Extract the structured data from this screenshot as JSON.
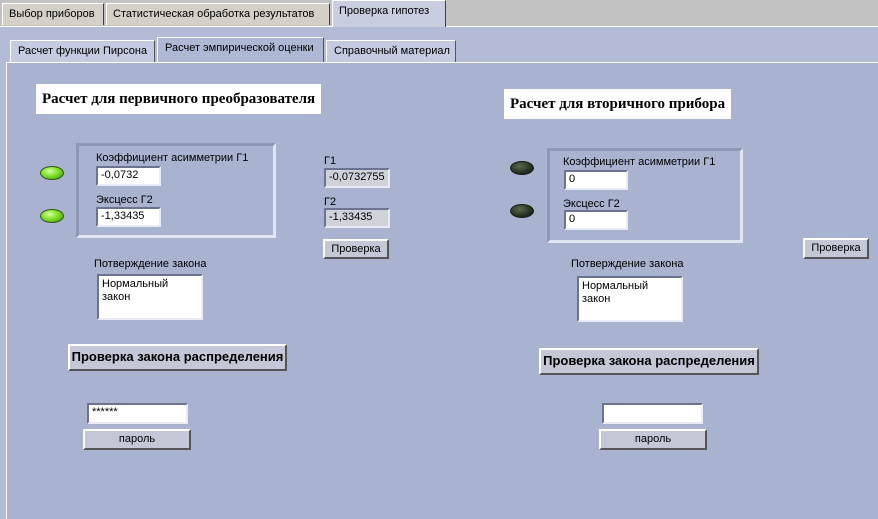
{
  "top_tabs": [
    {
      "label": "Выбор приборов"
    },
    {
      "label": "Статистическая обработка результатов"
    },
    {
      "label": "Проверка гипотез"
    }
  ],
  "sub_tabs": [
    {
      "label": "Расчет функции Пирсона"
    },
    {
      "label": "Расчет эмпирической оценки"
    },
    {
      "label": "Справочный материал"
    }
  ],
  "left": {
    "title": "Расчет для первичного преобразователя",
    "asym_label": "Коэффициент асимметрии Г1",
    "asym_value": "-0,0732",
    "excess_label": "Эксцесс Г2",
    "excess_value": "-1,33435",
    "g1_label": "Г1",
    "g1_value": "-0,0732755",
    "g2_label": "Г2",
    "g2_value": "-1,33435",
    "check_button": "Проверка",
    "confirm_label": "Потверждение закона",
    "confirm_value": "Нормальный закон",
    "law_button": "Проверка закона распределения",
    "password_value": "******",
    "password_button": "пароль",
    "led_asym": "on",
    "led_excess": "on"
  },
  "right": {
    "title": "Расчет для вторичного прибора",
    "asym_label": "Коэффициент асимметрии Г1",
    "asym_value": "0",
    "excess_label": "Эксцесс Г2",
    "excess_value": "0",
    "check_button": "Проверка",
    "confirm_label": "Потверждение закона",
    "confirm_value": "Нормальный\nзакон",
    "law_button": "Проверка закона распределения",
    "password_value": "",
    "password_button": "пароль",
    "led_asym": "off",
    "led_excess": "off"
  }
}
